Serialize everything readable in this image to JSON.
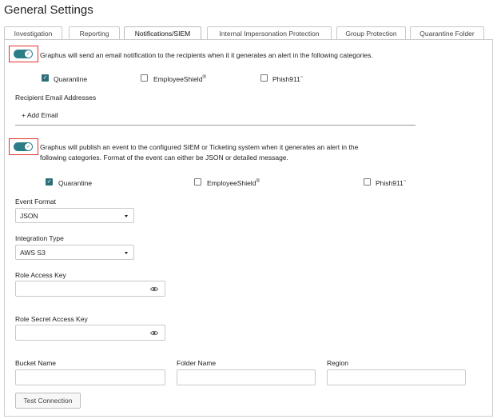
{
  "page": {
    "title": "General Settings"
  },
  "tabs": [
    {
      "label": "Investigation"
    },
    {
      "label": "Reporting"
    },
    {
      "label": "Notifications/SIEM"
    },
    {
      "label": "Internal Impersonation Protection"
    },
    {
      "label": "Group Protection"
    },
    {
      "label": "Quarantine Folder"
    }
  ],
  "active_tab": "Notifications/SIEM",
  "email_section": {
    "toggle_on": true,
    "description": "Graphus will send an email notification to the recipients when it it generates an alert in the following categories.",
    "categories": [
      {
        "label": "Quarantine",
        "checked": true
      },
      {
        "label": "EmployeeShield",
        "mark": "®",
        "checked": false
      },
      {
        "label": "Phish911",
        "mark": "~",
        "checked": false
      }
    ],
    "recipients_label": "Recipient Email Addresses",
    "add_email_label": "+ Add Email"
  },
  "siem_section": {
    "toggle_on": true,
    "description": "Graphus will publish an event to the configured SIEM or Ticketing system when it generates an alert in the following categories. Format of the event can either be JSON or detailed message.",
    "categories": [
      {
        "label": "Quarantine",
        "checked": true
      },
      {
        "label": "EmployeeShield",
        "mark": "®",
        "checked": false
      },
      {
        "label": "Phish911",
        "mark": "~",
        "checked": false
      }
    ],
    "event_format": {
      "label": "Event Format",
      "value": "JSON"
    },
    "integration_type": {
      "label": "Integration Type",
      "value": "AWS S3"
    },
    "role_access_key": {
      "label": "Role Access Key",
      "value": ""
    },
    "role_secret_access_key": {
      "label": "Role Secret Access Key",
      "value": ""
    },
    "bucket_name": {
      "label": "Bucket Name",
      "value": ""
    },
    "folder_name": {
      "label": "Folder Name",
      "value": ""
    },
    "region": {
      "label": "Region",
      "value": ""
    },
    "test_connection_label": "Test Connection"
  },
  "colors": {
    "toggle": "#2d7d86",
    "highlight_border": "#e0302a",
    "checkbox_checked": "#2d6f79"
  },
  "icons": {
    "toggle_check": "check-icon",
    "password_reveal": "eye-icon",
    "dropdown": "caret-down-icon"
  }
}
